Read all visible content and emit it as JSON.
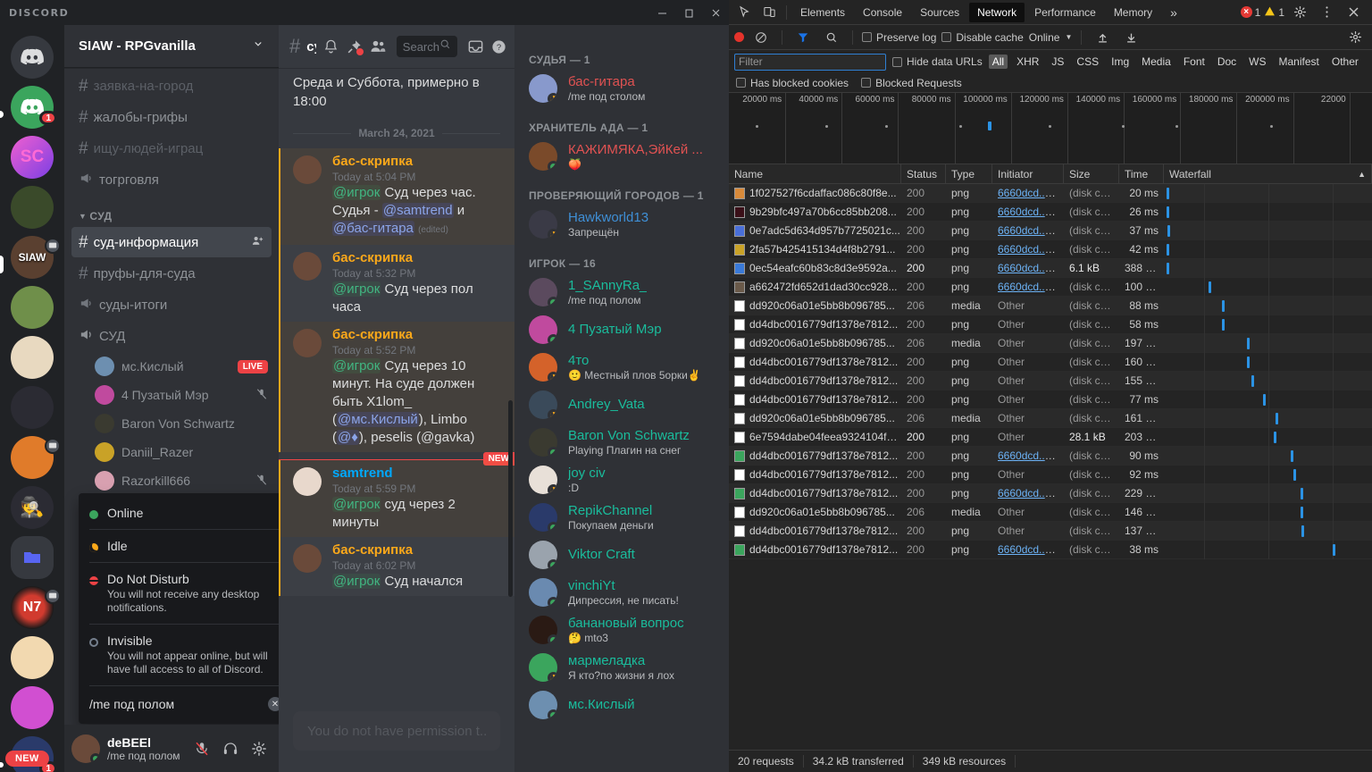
{
  "window": {
    "app_name": "DISCORD",
    "minimize": "minimize-icon",
    "maximize": "maximize-icon",
    "close": "close-icon"
  },
  "server_rail": {
    "servers": [
      {
        "name": "discord-home",
        "color": "#36393f",
        "badge": null,
        "pill": 0
      },
      {
        "name": "green-discord-server",
        "color": "#3ba55d",
        "badge": "1",
        "pill": 8
      },
      {
        "name": "sc-server",
        "color": "#b33fd6",
        "badge": null,
        "pill": 0
      },
      {
        "name": "green-creature-server",
        "color": "#3a4a2a",
        "badge": null,
        "pill": 0
      },
      {
        "name": "siaw-vanilla-server",
        "color": "#5a4030",
        "badge": null,
        "pill": 20,
        "screen": true
      },
      {
        "name": "minecraft-server",
        "color": "#6f8f4a",
        "badge": null,
        "pill": 0
      },
      {
        "name": "anime-girl-server",
        "color": "#e8d9c0",
        "badge": null,
        "pill": 0
      },
      {
        "name": "anime-dark-server",
        "color": "#2b2b33",
        "badge": null,
        "pill": 0
      },
      {
        "name": "sunset-server",
        "color": "#e07b2a",
        "badge": null,
        "pill": 0,
        "screen": true
      },
      {
        "name": "among-us-server",
        "color": "#2b2b33",
        "badge": null,
        "pill": 0
      },
      {
        "name": "folder-server",
        "color": "#36393f",
        "badge": null,
        "pill": 0,
        "folder": true
      },
      {
        "name": "n7-server",
        "color": "#c0392b",
        "badge": null,
        "pill": 0,
        "screen": true
      },
      {
        "name": "anime-blonde-server",
        "color": "#f2d9b0",
        "badge": null,
        "pill": 0
      },
      {
        "name": "pink-neon-server",
        "color": "#d14fd1",
        "badge": null,
        "pill": 0
      },
      {
        "name": "new-server",
        "color": "#2a3a6a",
        "badge": "1",
        "pill": 6,
        "new_label": "NEW"
      }
    ]
  },
  "sidebar": {
    "guild_name": "SIAW - RPGvanilla",
    "channels": [
      {
        "label": "заявка-на-город",
        "type": "text",
        "state": "dim",
        "cut": true
      },
      {
        "label": "жалобы-грифы",
        "type": "text",
        "state": "normal"
      },
      {
        "label": "ищу-людей-играц",
        "type": "text",
        "state": "dim"
      },
      {
        "label": "тогрговля",
        "type": "announcement",
        "state": "normal"
      }
    ],
    "category": "СУД",
    "channels2": [
      {
        "label": "суд-информация",
        "type": "text",
        "state": "active",
        "trailing": "add-member-icon"
      },
      {
        "label": "пруфы-для-суда",
        "type": "text",
        "state": "normal"
      },
      {
        "label": "суды-итоги",
        "type": "announcement",
        "state": "normal"
      }
    ],
    "voice_channel": {
      "label": "СУД",
      "type": "voice"
    },
    "voice_users": [
      {
        "name": "мс.Кислый",
        "badge": "LIVE",
        "muted": false,
        "color": "#6d8fb0"
      },
      {
        "name": "4 Пузатый Мэр",
        "badge": null,
        "muted": true,
        "color": "#c04a9e"
      },
      {
        "name": "Baron Von Schwartz",
        "badge": null,
        "muted": false,
        "color": "#3a3a30"
      },
      {
        "name": "Daniil_Razer",
        "badge": null,
        "muted": false,
        "color": "#c9a227"
      },
      {
        "name": "Razorkill666",
        "badge": null,
        "muted": true,
        "color": "#d8a0b0"
      }
    ]
  },
  "status_popout": {
    "items": [
      {
        "title": "Online",
        "desc": "",
        "color": "#3ba55d",
        "kind": "dot"
      },
      {
        "title": "Idle",
        "desc": "",
        "color": "#faa81a",
        "kind": "moon"
      },
      {
        "title": "Do Not Disturb",
        "desc": "You will not receive any desktop notifications.",
        "color": "#ed4245",
        "kind": "dnd"
      },
      {
        "title": "Invisible",
        "desc": "You will not appear online, but will have full access to all of Discord.",
        "color": "#747f8d",
        "kind": "ring"
      }
    ],
    "custom_status": "/me под полом",
    "clear_icon": "clear-status-icon"
  },
  "user_panel": {
    "username": "deBEEl",
    "substatus": "/me под полом",
    "mic_icon": "microphone-muted-icon",
    "headset_icon": "headset-icon",
    "settings_icon": "gear-icon"
  },
  "chat": {
    "channel_title": "суд-информа",
    "header_icons": [
      "bell-icon",
      "pin-icon",
      "members-icon",
      "inbox-icon",
      "help-icon"
    ],
    "search_placeholder": "Search",
    "search_icon": "search-icon",
    "pre_text": "Среда и Суббота, примерно в 18:00",
    "date_divider": "March 24, 2021",
    "messages": [
      {
        "author": "бас-скрипка",
        "author_color": "#faa81a",
        "time": "Today at 5:04 PM",
        "mention": "@игрок",
        "body": " Суд через час. Судья - ",
        "mention2": "@samtrend",
        "mid": " и ",
        "mention3": "@бас-гитара",
        "edited": "(edited)",
        "highlight": "mention"
      },
      {
        "author": "бас-скрипка",
        "author_color": "#faa81a",
        "time": "Today at 5:32 PM",
        "mention": "@игрок",
        "body": " Суд через пол часа",
        "highlight": "mention"
      },
      {
        "author": "бас-скрипка",
        "author_color": "#faa81a",
        "time": "Today at 5:52 PM",
        "mention": "@игрок",
        "body": " Суд через 10 минут. На суде должен быть X1lom_ (",
        "mention2": "@мс.Кислый",
        "mid": "), Limbo (",
        "mention3": "@♦",
        "tail": "), peselis (@gavka)",
        "highlight": "mention"
      },
      {
        "author": "samtrend",
        "author_color": "#00a8fc",
        "time": "Today at 5:59 PM",
        "mention": "@игрок",
        "body": " суд через 2 минуты",
        "highlight": "mention"
      },
      {
        "author": "бас-скрипка",
        "author_color": "#faa81a",
        "time": "Today at 6:02 PM",
        "mention": "@игрок",
        "body": " Суд начался",
        "highlight": "mention"
      }
    ],
    "new_label": "NEW",
    "input_placeholder": "You do not have permission t..."
  },
  "members": {
    "groups": [
      {
        "title": "СУДЬЯ — 1",
        "people": [
          {
            "name": "бас-гитара",
            "color": "#e05252",
            "sub": "/me под столом",
            "status": "idle",
            "av": "#8899cc"
          }
        ]
      },
      {
        "title": "ХРАНИТЕЛЬ АДА — 1",
        "people": [
          {
            "name": "КАЖИМЯКА,ЭйКей ...",
            "color": "#e05252",
            "sub": "🍑",
            "status": "online",
            "av": "#7a4a2a"
          }
        ]
      },
      {
        "title": "ПРОВЕРЯЮЩИЙ ГОРОДОВ — 1",
        "people": [
          {
            "name": "Hawkworld13",
            "color": "#3f8fd6",
            "sub": "Запрещён",
            "status": "idle",
            "av": "#3a3a46"
          }
        ]
      },
      {
        "title": "ИГРОК — 16",
        "people": [
          {
            "name": "1_SAnnyRa_",
            "color": "#1abc9c",
            "sub": "/me под полом",
            "status": "online",
            "av": "#5b4a5e"
          },
          {
            "name": "4 Пузатый Мэр",
            "color": "#1abc9c",
            "sub": "",
            "status": "online",
            "av": "#c04a9e"
          },
          {
            "name": "4то",
            "color": "#1abc9c",
            "sub": "🙂 Местный плов 5орки✌",
            "status": "idle",
            "av": "#d4622a"
          },
          {
            "name": "Andrey_Vata",
            "color": "#1abc9c",
            "sub": "",
            "status": "idle",
            "av": "#3a4a5a"
          },
          {
            "name": "Baron Von Schwartz",
            "color": "#1abc9c",
            "sub": "Playing Плагин на снег",
            "status": "online",
            "av": "#3a3a30"
          },
          {
            "name": "joy civ",
            "color": "#1abc9c",
            "sub": ":D",
            "status": "idle",
            "av": "#e8e0d8"
          },
          {
            "name": "RepikChannel",
            "color": "#1abc9c",
            "sub": "Покупаем деньги",
            "status": "online",
            "av": "#2a3a6a"
          },
          {
            "name": "Viktor Craft",
            "color": "#1abc9c",
            "sub": "",
            "status": "online",
            "av": "#9aa3ad"
          },
          {
            "name": "vinchiYt",
            "color": "#1abc9c",
            "sub": "Дипрессия, не писать!",
            "status": "online",
            "av": "#6a8ab0"
          },
          {
            "name": "банановый вопрос",
            "color": "#1abc9c",
            "sub": "🤔 mto3",
            "status": "online",
            "av": "#2a1a14"
          },
          {
            "name": "мармеладка",
            "color": "#1abc9c",
            "sub": "Я кто?по жизни я лох",
            "status": "idle",
            "av": "#3ba55d"
          },
          {
            "name": "мс.Кислый",
            "color": "#1abc9c",
            "sub": "",
            "status": "online",
            "av": "#6d8fb0"
          }
        ]
      }
    ]
  },
  "devtools": {
    "tabs": [
      {
        "label": "Elements",
        "active": false
      },
      {
        "label": "Console",
        "active": false
      },
      {
        "label": "Sources",
        "active": false
      },
      {
        "label": "Network",
        "active": true
      },
      {
        "label": "Performance",
        "active": false
      },
      {
        "label": "Memory",
        "active": false
      }
    ],
    "more_tabs_icon": "chevron-double-right-icon",
    "inspect_icon": "inspect-element-icon",
    "device_icon": "device-toolbar-icon",
    "error_count": "1",
    "warning_count": "1",
    "settings_icon": "gear-icon",
    "kebab_icon": "more-options-icon",
    "close_icon": "close-icon",
    "record_icon": "record-button",
    "clear_icon": "clear-icon",
    "filter_icon": "filter-icon",
    "search_icon": "search-icon",
    "preserve_log": "Preserve log",
    "disable_cache": "Disable cache",
    "throttling": "Online",
    "import_icon": "import-har-icon",
    "export_icon": "export-har-icon",
    "network_settings_icon": "network-settings-icon",
    "filter_placeholder": "Filter",
    "hide_data_urls": "Hide data URLs",
    "resource_types": [
      "All",
      "XHR",
      "JS",
      "CSS",
      "Img",
      "Media",
      "Font",
      "Doc",
      "WS",
      "Manifest",
      "Other"
    ],
    "selected_type": "All",
    "has_blocked_cookies": "Has blocked cookies",
    "blocked_requests": "Blocked Requests",
    "timeline_ticks": [
      "20000 ms",
      "40000 ms",
      "60000 ms",
      "80000 ms",
      "100000 ms",
      "120000 ms",
      "140000 ms",
      "160000 ms",
      "180000 ms",
      "200000 ms",
      "22000"
    ],
    "columns": [
      "Name",
      "Status",
      "Type",
      "Initiator",
      "Size",
      "Time",
      "Waterfall"
    ],
    "sort_icon": "sort-ascending-icon",
    "requests": [
      {
        "name": "1f027527f6cdaffac086c80f8e...",
        "status": "200",
        "type": "png",
        "initiator": "6660dcd....js:2",
        "link": true,
        "size": "(disk ca...",
        "time": "20 ms",
        "wf": 0.5,
        "ico": "#d88a3a"
      },
      {
        "name": "9b29bfc497a70b6cc85bb208...",
        "status": "200",
        "type": "png",
        "initiator": "6660dcd....js:2",
        "link": true,
        "size": "(disk ca...",
        "time": "26 ms",
        "wf": 0.5,
        "ico": "#3a1018"
      },
      {
        "name": "0e7adc5d634d957b7725021c...",
        "status": "200",
        "type": "png",
        "initiator": "6660dcd....js:2",
        "link": true,
        "size": "(disk ca...",
        "time": "37 ms",
        "wf": 0.8,
        "ico": "#4a6fd8"
      },
      {
        "name": "2fa57b425415134d4f8b2791...",
        "status": "200",
        "type": "png",
        "initiator": "6660dcd....js:2",
        "link": true,
        "size": "(disk ca...",
        "time": "42 ms",
        "wf": 0.5,
        "ico": "#c9a227"
      },
      {
        "name": "0ec54eafc60b83c8d3e9592a...",
        "status": "200",
        "type": "png",
        "initiator": "6660dcd....js:2",
        "link": true,
        "size": "6.1 kB",
        "time": "388 ms",
        "wf": 0.5,
        "ico": "#3a7ad8",
        "bold": true
      },
      {
        "name": "a662472fd652d1dad30cc928...",
        "status": "200",
        "type": "png",
        "initiator": "6660dcd....js:2",
        "link": true,
        "size": "(disk ca...",
        "time": "100 ms",
        "wf": 24.5,
        "ico": "#6a5a4a"
      },
      {
        "name": "dd920c06a01e5bb8b096785...",
        "status": "206",
        "type": "media",
        "initiator": "Other",
        "link": false,
        "size": "(disk ca...",
        "time": "88 ms",
        "wf": 32.5,
        "ico": "#ffffff"
      },
      {
        "name": "dd4dbc0016779df1378e7812...",
        "status": "200",
        "type": "png",
        "initiator": "Other",
        "link": false,
        "size": "(disk ca...",
        "time": "58 ms",
        "wf": 32.5,
        "ico": "#ffffff"
      },
      {
        "name": "dd920c06a01e5bb8b096785...",
        "status": "206",
        "type": "media",
        "initiator": "Other",
        "link": false,
        "size": "(disk ca...",
        "time": "197 ms",
        "wf": 46.5,
        "ico": "#ffffff"
      },
      {
        "name": "dd4dbc0016779df1378e7812...",
        "status": "200",
        "type": "png",
        "initiator": "Other",
        "link": false,
        "size": "(disk ca...",
        "time": "160 ms",
        "wf": 46.5,
        "ico": "#ffffff"
      },
      {
        "name": "dd4dbc0016779df1378e7812...",
        "status": "200",
        "type": "png",
        "initiator": "Other",
        "link": false,
        "size": "(disk ca...",
        "time": "155 ms",
        "wf": 49.0,
        "ico": "#ffffff"
      },
      {
        "name": "dd4dbc0016779df1378e7812...",
        "status": "200",
        "type": "png",
        "initiator": "Other",
        "link": false,
        "size": "(disk ca...",
        "time": "77 ms",
        "wf": 56.0,
        "ico": "#ffffff"
      },
      {
        "name": "dd920c06a01e5bb8b096785...",
        "status": "206",
        "type": "media",
        "initiator": "Other",
        "link": false,
        "size": "(disk ca...",
        "time": "161 ms",
        "wf": 63.0,
        "ico": "#ffffff"
      },
      {
        "name": "6e7594dabe04feea9324104fa...",
        "status": "200",
        "type": "png",
        "initiator": "Other",
        "link": false,
        "size": "28.1 kB",
        "time": "203 ms",
        "wf": 62.0,
        "ico": "#ffffff",
        "bold": true
      },
      {
        "name": "dd4dbc0016779df1378e7812...",
        "status": "200",
        "type": "png",
        "initiator": "6660dcd....js:2",
        "link": true,
        "size": "(disk ca...",
        "time": "90 ms",
        "wf": 72.0,
        "ico": "#3ba55d"
      },
      {
        "name": "dd4dbc0016779df1378e7812...",
        "status": "200",
        "type": "png",
        "initiator": "Other",
        "link": false,
        "size": "(disk ca...",
        "time": "92 ms",
        "wf": 73.5,
        "ico": "#ffffff"
      },
      {
        "name": "dd4dbc0016779df1378e7812...",
        "status": "200",
        "type": "png",
        "initiator": "6660dcd....js:2",
        "link": true,
        "size": "(disk ca...",
        "time": "229 ms",
        "wf": 77.5,
        "ico": "#3ba55d"
      },
      {
        "name": "dd920c06a01e5bb8b096785...",
        "status": "206",
        "type": "media",
        "initiator": "Other",
        "link": false,
        "size": "(disk ca...",
        "time": "146 ms",
        "wf": 77.5,
        "ico": "#ffffff"
      },
      {
        "name": "dd4dbc0016779df1378e7812...",
        "status": "200",
        "type": "png",
        "initiator": "Other",
        "link": false,
        "size": "(disk ca...",
        "time": "137 ms",
        "wf": 78.0,
        "ico": "#ffffff"
      },
      {
        "name": "dd4dbc0016779df1378e7812...",
        "status": "200",
        "type": "png",
        "initiator": "6660dcd....js:2",
        "link": true,
        "size": "(disk ca...",
        "time": "38 ms",
        "wf": 96.0,
        "ico": "#3ba55d"
      }
    ],
    "status_bar": [
      "20 requests",
      "34.2 kB transferred",
      "349 kB resources"
    ]
  }
}
